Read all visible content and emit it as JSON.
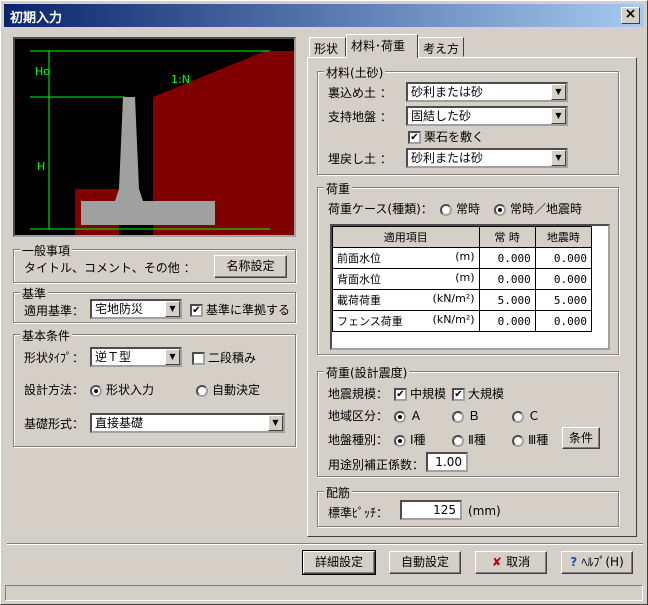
{
  "window": {
    "title": "初期入力",
    "close": "×"
  },
  "figure": {
    "label_ho": "Ho",
    "label_h": "H",
    "label_slope": "1:N"
  },
  "general": {
    "title": "一般事項",
    "desc": "タイトル、コメント、その他 ：",
    "button": "名称設定"
  },
  "standard": {
    "title": "基準",
    "label": "適用基準：",
    "value": "宅地防災",
    "check_label": "基準に準拠する"
  },
  "basic": {
    "title": "基本条件",
    "shape_label": "形状ﾀｲﾌﾟ：",
    "shape_value": "逆Ｔ型",
    "two_step": "二段積み",
    "method_label": "設計方法：",
    "method_opt1": "形状入力",
    "method_opt2": "自動決定",
    "foundation_label": "基礎形式：",
    "foundation_value": "直接基礎"
  },
  "tabs": [
    "形状",
    "材料･荷重",
    "考え方"
  ],
  "material": {
    "title": "材料(土砂)",
    "backfill_label": "裏込め土 ：",
    "backfill_value": "砂利または砂",
    "support_label": "支持地盤 ：",
    "support_value": "固結した砂",
    "gravel_label": "栗石を敷く",
    "refill_label": "埋戻し土 ：",
    "refill_value": "砂利または砂"
  },
  "load": {
    "title": "荷重",
    "case_label": "荷重ケース(種類)：",
    "case_opt1": "常時",
    "case_opt2": "常時／地震時",
    "headers": [
      "適用項目",
      "常 時",
      "地震時"
    ],
    "rows": [
      {
        "name": "前面水位",
        "unit": "(m)",
        "v1": "0.000",
        "v2": "0.000"
      },
      {
        "name": "背面水位",
        "unit": "(m)",
        "v1": "0.000",
        "v2": "0.000"
      },
      {
        "name": "載荷荷重",
        "unit": "(kN/m²)",
        "v1": "5.000",
        "v2": "5.000"
      },
      {
        "name": "フェンス荷重",
        "unit": "(kN/m²)",
        "v1": "0.000",
        "v2": "0.000"
      }
    ]
  },
  "seismic": {
    "title": "荷重(設計震度)",
    "scale_label": "地震規模：",
    "scale_mid": "中規模",
    "scale_large": "大規模",
    "region_label": "地域区分：",
    "region_a": "Ａ",
    "region_b": "Ｂ",
    "region_c": "Ｃ",
    "ground_label": "地盤種別：",
    "ground_1": "Ⅰ種",
    "ground_2": "Ⅱ種",
    "ground_3": "Ⅲ種",
    "cond_button": "条件",
    "coef_label": "用途別補正係数：",
    "coef_value": "1.00"
  },
  "rebar": {
    "title": "配筋",
    "pitch_label": "標準ﾋﾟｯﾁ：",
    "pitch_value": "125",
    "pitch_unit": "(mm)"
  },
  "footer": {
    "detail": "詳細設定",
    "auto": "自動設定",
    "cancel": "取消",
    "help": "ﾍﾙﾌﾟ(H)"
  }
}
